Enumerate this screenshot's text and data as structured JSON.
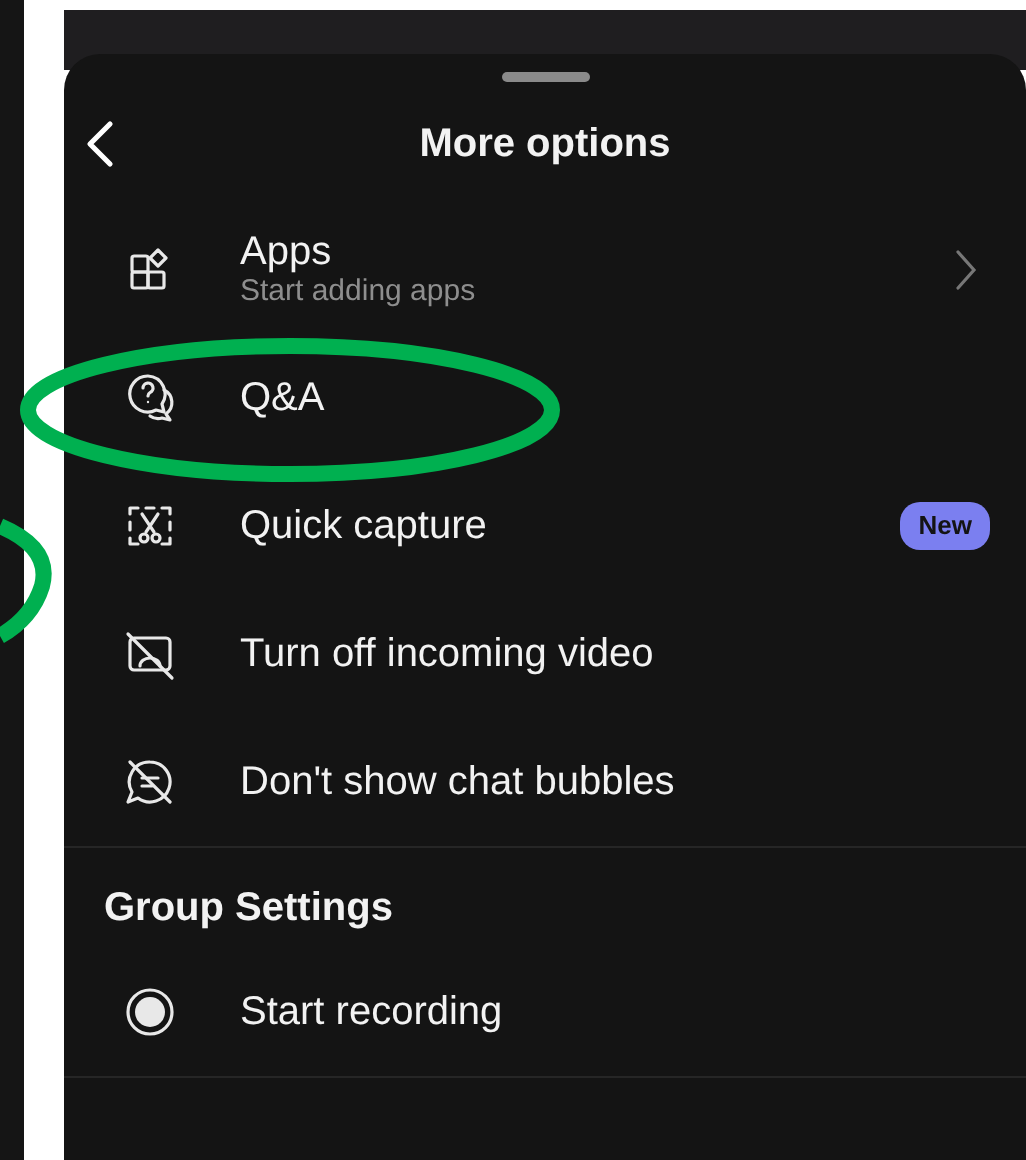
{
  "sheet": {
    "title": "More options"
  },
  "items": [
    {
      "kind": "apps",
      "label": "Apps",
      "subtitle": "Start adding apps",
      "chevron": true
    },
    {
      "kind": "qa",
      "label": "Q&A"
    },
    {
      "kind": "capture",
      "label": "Quick capture",
      "badge": "New"
    },
    {
      "kind": "video-off",
      "label": "Turn off incoming video"
    },
    {
      "kind": "chat-off",
      "label": "Don't show chat bubbles"
    }
  ],
  "group_settings": {
    "heading": "Group Settings",
    "items": [
      {
        "kind": "record",
        "label": "Start recording"
      }
    ]
  }
}
